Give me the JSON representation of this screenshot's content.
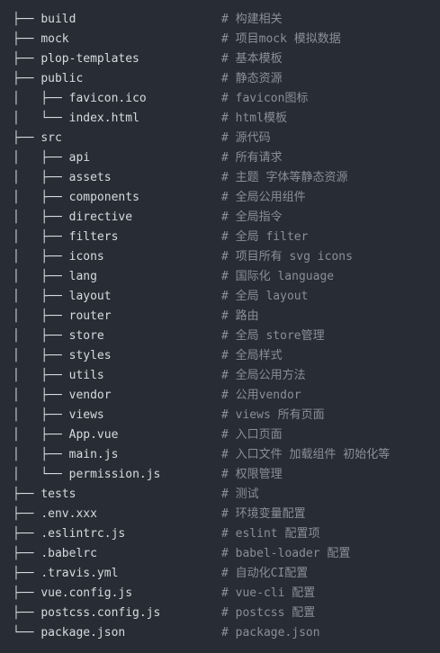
{
  "tree": [
    {
      "prefix": "├── ",
      "name": "build",
      "comment": "# 构建相关"
    },
    {
      "prefix": "├── ",
      "name": "mock",
      "comment": "# 项目mock 模拟数据"
    },
    {
      "prefix": "├── ",
      "name": "plop-templates",
      "comment": "# 基本模板"
    },
    {
      "prefix": "├── ",
      "name": "public",
      "comment": "# 静态资源"
    },
    {
      "prefix": "│   ├── ",
      "name": "favicon.ico",
      "comment": "# favicon图标"
    },
    {
      "prefix": "│   └── ",
      "name": "index.html",
      "comment": "# html模板"
    },
    {
      "prefix": "├── ",
      "name": "src",
      "comment": "# 源代码"
    },
    {
      "prefix": "│   ├── ",
      "name": "api",
      "comment": "# 所有请求"
    },
    {
      "prefix": "│   ├── ",
      "name": "assets",
      "comment": "# 主题 字体等静态资源"
    },
    {
      "prefix": "│   ├── ",
      "name": "components",
      "comment": "# 全局公用组件"
    },
    {
      "prefix": "│   ├── ",
      "name": "directive",
      "comment": "# 全局指令"
    },
    {
      "prefix": "│   ├── ",
      "name": "filters",
      "comment": "# 全局 filter"
    },
    {
      "prefix": "│   ├── ",
      "name": "icons",
      "comment": "# 项目所有 svg icons"
    },
    {
      "prefix": "│   ├── ",
      "name": "lang",
      "comment": "# 国际化 language"
    },
    {
      "prefix": "│   ├── ",
      "name": "layout",
      "comment": "# 全局 layout"
    },
    {
      "prefix": "│   ├── ",
      "name": "router",
      "comment": "# 路由"
    },
    {
      "prefix": "│   ├── ",
      "name": "store",
      "comment": "# 全局 store管理"
    },
    {
      "prefix": "│   ├── ",
      "name": "styles",
      "comment": "# 全局样式"
    },
    {
      "prefix": "│   ├── ",
      "name": "utils",
      "comment": "# 全局公用方法"
    },
    {
      "prefix": "│   ├── ",
      "name": "vendor",
      "comment": "# 公用vendor"
    },
    {
      "prefix": "│   ├── ",
      "name": "views",
      "comment": "# views 所有页面"
    },
    {
      "prefix": "│   ├── ",
      "name": "App.vue",
      "comment": "# 入口页面"
    },
    {
      "prefix": "│   ├── ",
      "name": "main.js",
      "comment": "# 入口文件 加载组件 初始化等"
    },
    {
      "prefix": "│   └── ",
      "name": "permission.js",
      "comment": "# 权限管理"
    },
    {
      "prefix": "├── ",
      "name": "tests",
      "comment": "# 测试"
    },
    {
      "prefix": "├── ",
      "name": ".env.xxx",
      "comment": "# 环境变量配置"
    },
    {
      "prefix": "├── ",
      "name": ".eslintrc.js",
      "comment": "# eslint 配置项"
    },
    {
      "prefix": "├── ",
      "name": ".babelrc",
      "comment": "# babel-loader 配置"
    },
    {
      "prefix": "├── ",
      "name": ".travis.yml",
      "comment": "# 自动化CI配置"
    },
    {
      "prefix": "├── ",
      "name": "vue.config.js",
      "comment": "# vue-cli 配置"
    },
    {
      "prefix": "├── ",
      "name": "postcss.config.js",
      "comment": "# postcss 配置"
    },
    {
      "prefix": "└── ",
      "name": "package.json",
      "comment": "# package.json"
    }
  ]
}
